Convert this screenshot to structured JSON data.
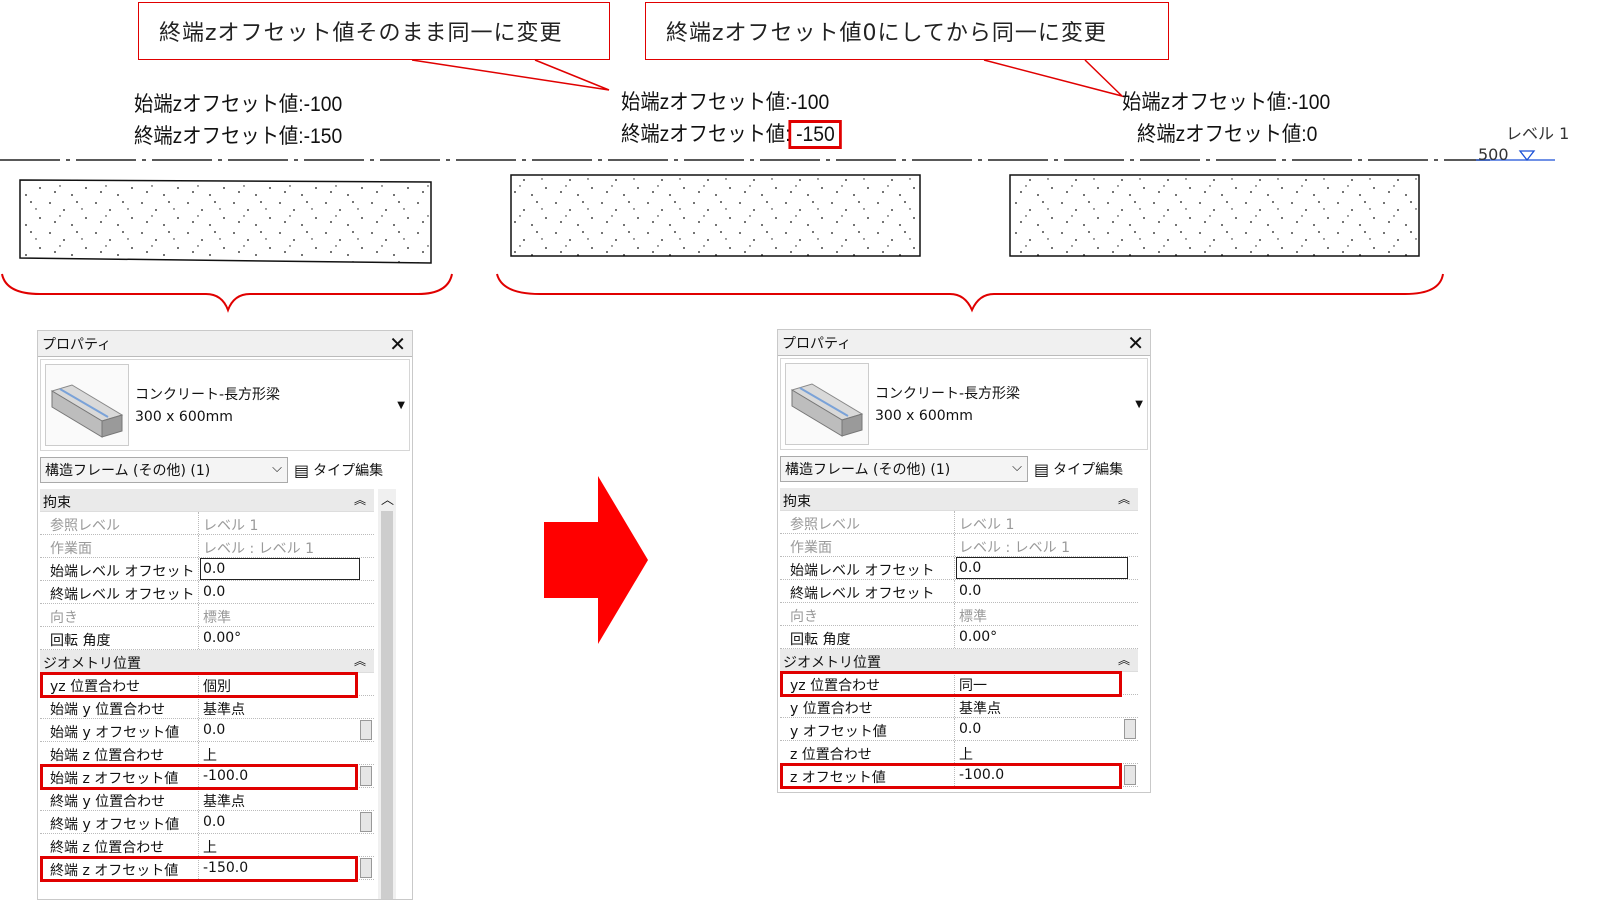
{
  "callouts": {
    "left": "終端zオフセット値そのまま同一に変更",
    "right": "終端zオフセット値0にしてから同一に変更"
  },
  "beam_labels": {
    "b1": {
      "start": "始端zオフセット値:-100",
      "end": "終端zオフセット値:-150"
    },
    "b2": {
      "start": "始端zオフセット値:-100",
      "end_prefix": "終端zオフセット値:",
      "end_value": "-150"
    },
    "b3": {
      "start": "始端zオフセット値:-100",
      "end": "終端zオフセット値:0"
    }
  },
  "level": {
    "name": "レベル 1",
    "value": "500"
  },
  "panel_left": {
    "title": "プロパティ",
    "type_name": "コンクリート-長方形梁",
    "type_size": "300 x 600mm",
    "selector": "構造フレーム (その他) (1)",
    "type_edit": "タイプ編集",
    "sections": {
      "constraints": "拘束",
      "geometry": "ジオメトリ位置"
    },
    "rows": {
      "ref_level": {
        "k": "参照レベル",
        "v": "レベル 1"
      },
      "work_plane": {
        "k": "作業面",
        "v": "レベル : レベル 1"
      },
      "start_level_offset": {
        "k": "始端レベル オフセット",
        "v": "0.0"
      },
      "end_level_offset": {
        "k": "終端レベル オフセット",
        "v": "0.0"
      },
      "orientation": {
        "k": "向き",
        "v": "標準"
      },
      "rotation": {
        "k": "回転 角度",
        "v": "0.00°"
      },
      "yz_justification": {
        "k": "yz 位置合わせ",
        "v": "個別"
      },
      "start_y_just": {
        "k": "始端 y 位置合わせ",
        "v": "基準点"
      },
      "start_y_offset": {
        "k": "始端 y オフセット値",
        "v": "0.0"
      },
      "start_z_just": {
        "k": "始端 z 位置合わせ",
        "v": "上"
      },
      "start_z_offset": {
        "k": "始端 z オフセット値",
        "v": "-100.0"
      },
      "end_y_just": {
        "k": "終端 y 位置合わせ",
        "v": "基準点"
      },
      "end_y_offset": {
        "k": "終端 y オフセット値",
        "v": "0.0"
      },
      "end_z_just": {
        "k": "終端 z 位置合わせ",
        "v": "上"
      },
      "end_z_offset": {
        "k": "終端 z オフセット値",
        "v": "-150.0"
      }
    }
  },
  "panel_right": {
    "title": "プロパティ",
    "type_name": "コンクリート-長方形梁",
    "type_size": "300 x 600mm",
    "selector": "構造フレーム (その他) (1)",
    "type_edit": "タイプ編集",
    "sections": {
      "constraints": "拘束",
      "geometry": "ジオメトリ位置"
    },
    "rows": {
      "ref_level": {
        "k": "参照レベル",
        "v": "レベル 1"
      },
      "work_plane": {
        "k": "作業面",
        "v": "レベル : レベル 1"
      },
      "start_level_offset": {
        "k": "始端レベル オフセット",
        "v": "0.0"
      },
      "end_level_offset": {
        "k": "終端レベル オフセット",
        "v": "0.0"
      },
      "orientation": {
        "k": "向き",
        "v": "標準"
      },
      "rotation": {
        "k": "回転 角度",
        "v": "0.00°"
      },
      "yz_justification": {
        "k": "yz 位置合わせ",
        "v": "同一"
      },
      "y_just": {
        "k": "y 位置合わせ",
        "v": "基準点"
      },
      "y_offset": {
        "k": "y オフセット値",
        "v": "0.0"
      },
      "z_just": {
        "k": "z 位置合わせ",
        "v": "上"
      },
      "z_offset": {
        "k": "z オフセット値",
        "v": "-100.0"
      }
    }
  },
  "colors": {
    "highlight": "#e00000",
    "arrow": "#ff0000",
    "level": "#1a4fd6"
  }
}
